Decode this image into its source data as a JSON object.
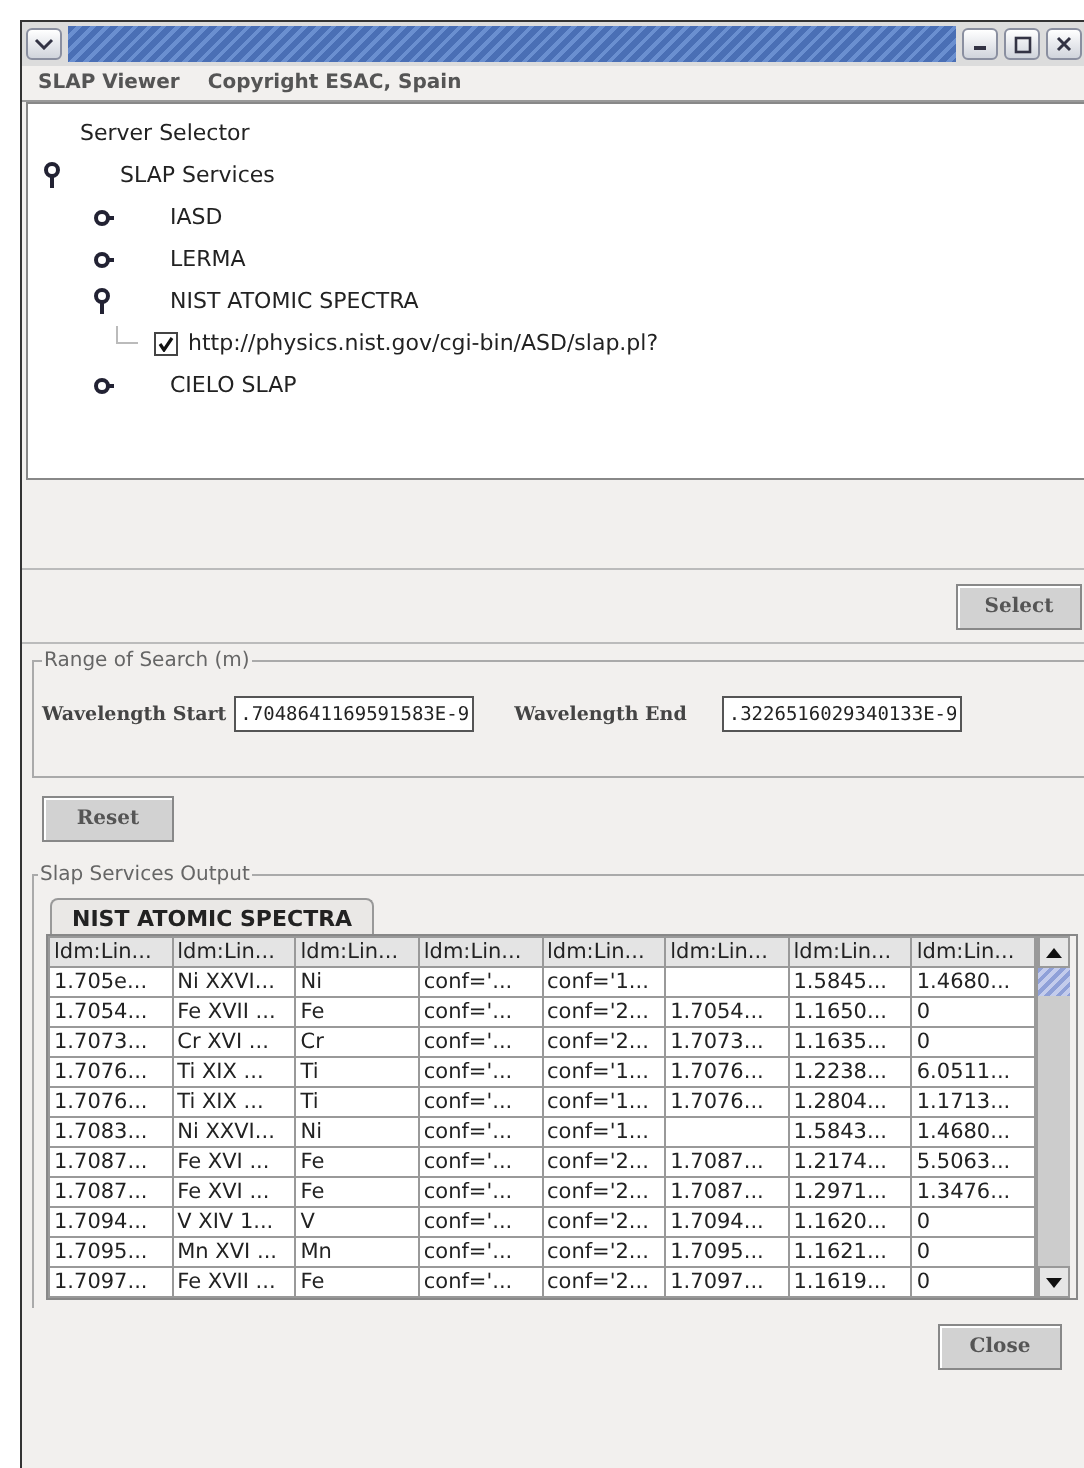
{
  "menu": [
    "SLAP Viewer",
    "Copyright ESAC, Spain"
  ],
  "tree": {
    "title": "Server Selector",
    "nodes": [
      {
        "label": "SLAP Services",
        "expanded": true,
        "children": [
          {
            "label": "IASD",
            "expanded": false
          },
          {
            "label": "LERMA",
            "expanded": false
          },
          {
            "label": "NIST ATOMIC SPECTRA",
            "expanded": true,
            "children": [
              {
                "label": "http://physics.nist.gov/cgi-bin/ASD/slap.pl?",
                "checked": true
              }
            ]
          },
          {
            "label": "CIELO SLAP",
            "expanded": false
          }
        ]
      }
    ]
  },
  "select_button": "Select",
  "range": {
    "title": "Range of Search (m)",
    "start_label": "Wavelength Start",
    "start_value": ".7048641169591583E-9",
    "end_label": "Wavelength End",
    "end_value": ".3226516029340133E-9"
  },
  "reset_button": "Reset",
  "output": {
    "title": "Slap Services Output",
    "tab": "NIST ATOMIC SPECTRA",
    "table": {
      "columns": [
        "ldm:Lin...",
        "ldm:Lin...",
        "ldm:Lin...",
        "ldm:Lin...",
        "ldm:Lin...",
        "ldm:Lin...",
        "ldm:Lin...",
        "ldm:Lin..."
      ],
      "rows": [
        [
          "1.705e...",
          "Ni XXVI...",
          "Ni",
          "conf='...",
          "conf='1...",
          "",
          "1.5845...",
          "1.4680..."
        ],
        [
          "1.7054...",
          "Fe XVII ...",
          "Fe",
          "conf='...",
          "conf='2...",
          "1.7054...",
          "1.1650...",
          "0"
        ],
        [
          "1.7073...",
          "Cr XVI ...",
          "Cr",
          "conf='...",
          "conf='2...",
          "1.7073...",
          "1.1635...",
          "0"
        ],
        [
          "1.7076...",
          "Ti XIX ...",
          "Ti",
          "conf='...",
          "conf='1...",
          "1.7076...",
          "1.2238...",
          "6.0511..."
        ],
        [
          "1.7076...",
          "Ti XIX ...",
          "Ti",
          "conf='...",
          "conf='1...",
          "1.7076...",
          "1.2804...",
          "1.1713..."
        ],
        [
          "1.7083...",
          "Ni XXVI...",
          "Ni",
          "conf='...",
          "conf='1...",
          "",
          "1.5843...",
          "1.4680..."
        ],
        [
          "1.7087...",
          "Fe XVI ...",
          "Fe",
          "conf='...",
          "conf='2...",
          "1.7087...",
          "1.2174...",
          "5.5063..."
        ],
        [
          "1.7087...",
          "Fe XVI ...",
          "Fe",
          "conf='...",
          "conf='2...",
          "1.7087...",
          "1.2971...",
          "1.3476..."
        ],
        [
          "1.7094...",
          "V XIV 1...",
          "V",
          "conf='...",
          "conf='2...",
          "1.7094...",
          "1.1620...",
          "0"
        ],
        [
          "1.7095...",
          "Mn XVI ...",
          "Mn",
          "conf='...",
          "conf='2...",
          "1.7095...",
          "1.1621...",
          "0"
        ],
        [
          "1.7097...",
          "Fe XVII ...",
          "Fe",
          "conf='...",
          "conf='2...",
          "1.7097...",
          "1.1619...",
          "0"
        ]
      ]
    }
  },
  "close_button": "Close"
}
